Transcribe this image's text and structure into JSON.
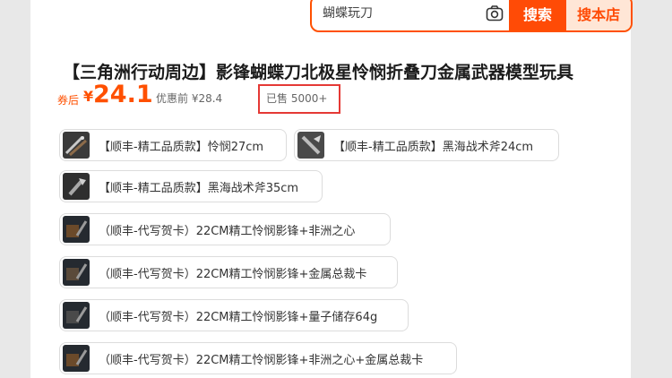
{
  "search": {
    "placeholder": "蝴蝶玩刀",
    "search_button": "搜索",
    "shop_button": "搜本店"
  },
  "product": {
    "title": "【三角洲行动周边】影锋蝴蝶刀北极星怜悯折叠刀金属武器模型玩具",
    "price_label": "券后",
    "currency": "¥",
    "price": "24.1",
    "original_price": "优惠前 ¥28.4",
    "sold": "已售 5000+"
  },
  "skus": [
    {
      "label": "【顺丰-精工品质款】怜悯27cm"
    },
    {
      "label": "【顺丰-精工品质款】黑海战术斧24cm"
    },
    {
      "label": "【顺丰-精工品质款】黑海战术斧35cm"
    },
    {
      "label": "（顺丰-代写贺卡）22CM精工怜悯影锋+非洲之心"
    },
    {
      "label": "（顺丰-代写贺卡）22CM精工怜悯影锋+金属总裁卡"
    },
    {
      "label": "（顺丰-代写贺卡）22CM精工怜悯影锋+量子储存64g"
    },
    {
      "label": "（顺丰-代写贺卡）22CM精工怜悯影锋+非洲之心+金属总裁卡"
    }
  ],
  "colors": {
    "accent": "#ff5000",
    "highlight_box": "#e53935"
  }
}
